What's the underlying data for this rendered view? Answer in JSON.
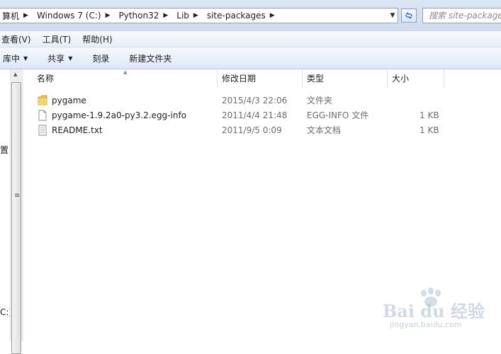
{
  "address": {
    "crumbs": [
      "算机",
      "Windows 7 (C:)",
      "Python32",
      "Lib",
      "site-packages"
    ],
    "search_placeholder": "搜索 site-packages"
  },
  "menu": [
    "查看(V)",
    "工具(T)",
    "帮助(H)"
  ],
  "toolbar": {
    "library": "库中",
    "share": "共享",
    "burn": "刻录",
    "new_folder": "新建文件夹"
  },
  "nav": {
    "item_1": "置",
    "item_2": "C:)"
  },
  "columns": [
    "名称",
    "修改日期",
    "类型",
    "大小"
  ],
  "files": [
    {
      "name": "pygame",
      "date": "2015/4/3 22:06",
      "type": "文件夹",
      "size": "",
      "icon": "folder-icon"
    },
    {
      "name": "pygame-1.9.2a0-py3.2.egg-info",
      "date": "2011/4/4 21:48",
      "type": "EGG-INFO 文件",
      "size": "1 KB",
      "icon": "file-icon"
    },
    {
      "name": "README.txt",
      "date": "2011/9/5 0:09",
      "type": "文本文档",
      "size": "1 KB",
      "icon": "text-file-icon"
    }
  ],
  "watermark": {
    "main": "Bai du 经验",
    "sub": "jingyan.baidu.com"
  },
  "colors": {
    "chrome_blue": "#dbe6f4",
    "folder_yellow": "#e9c24d",
    "border": "#8e9fb7"
  }
}
